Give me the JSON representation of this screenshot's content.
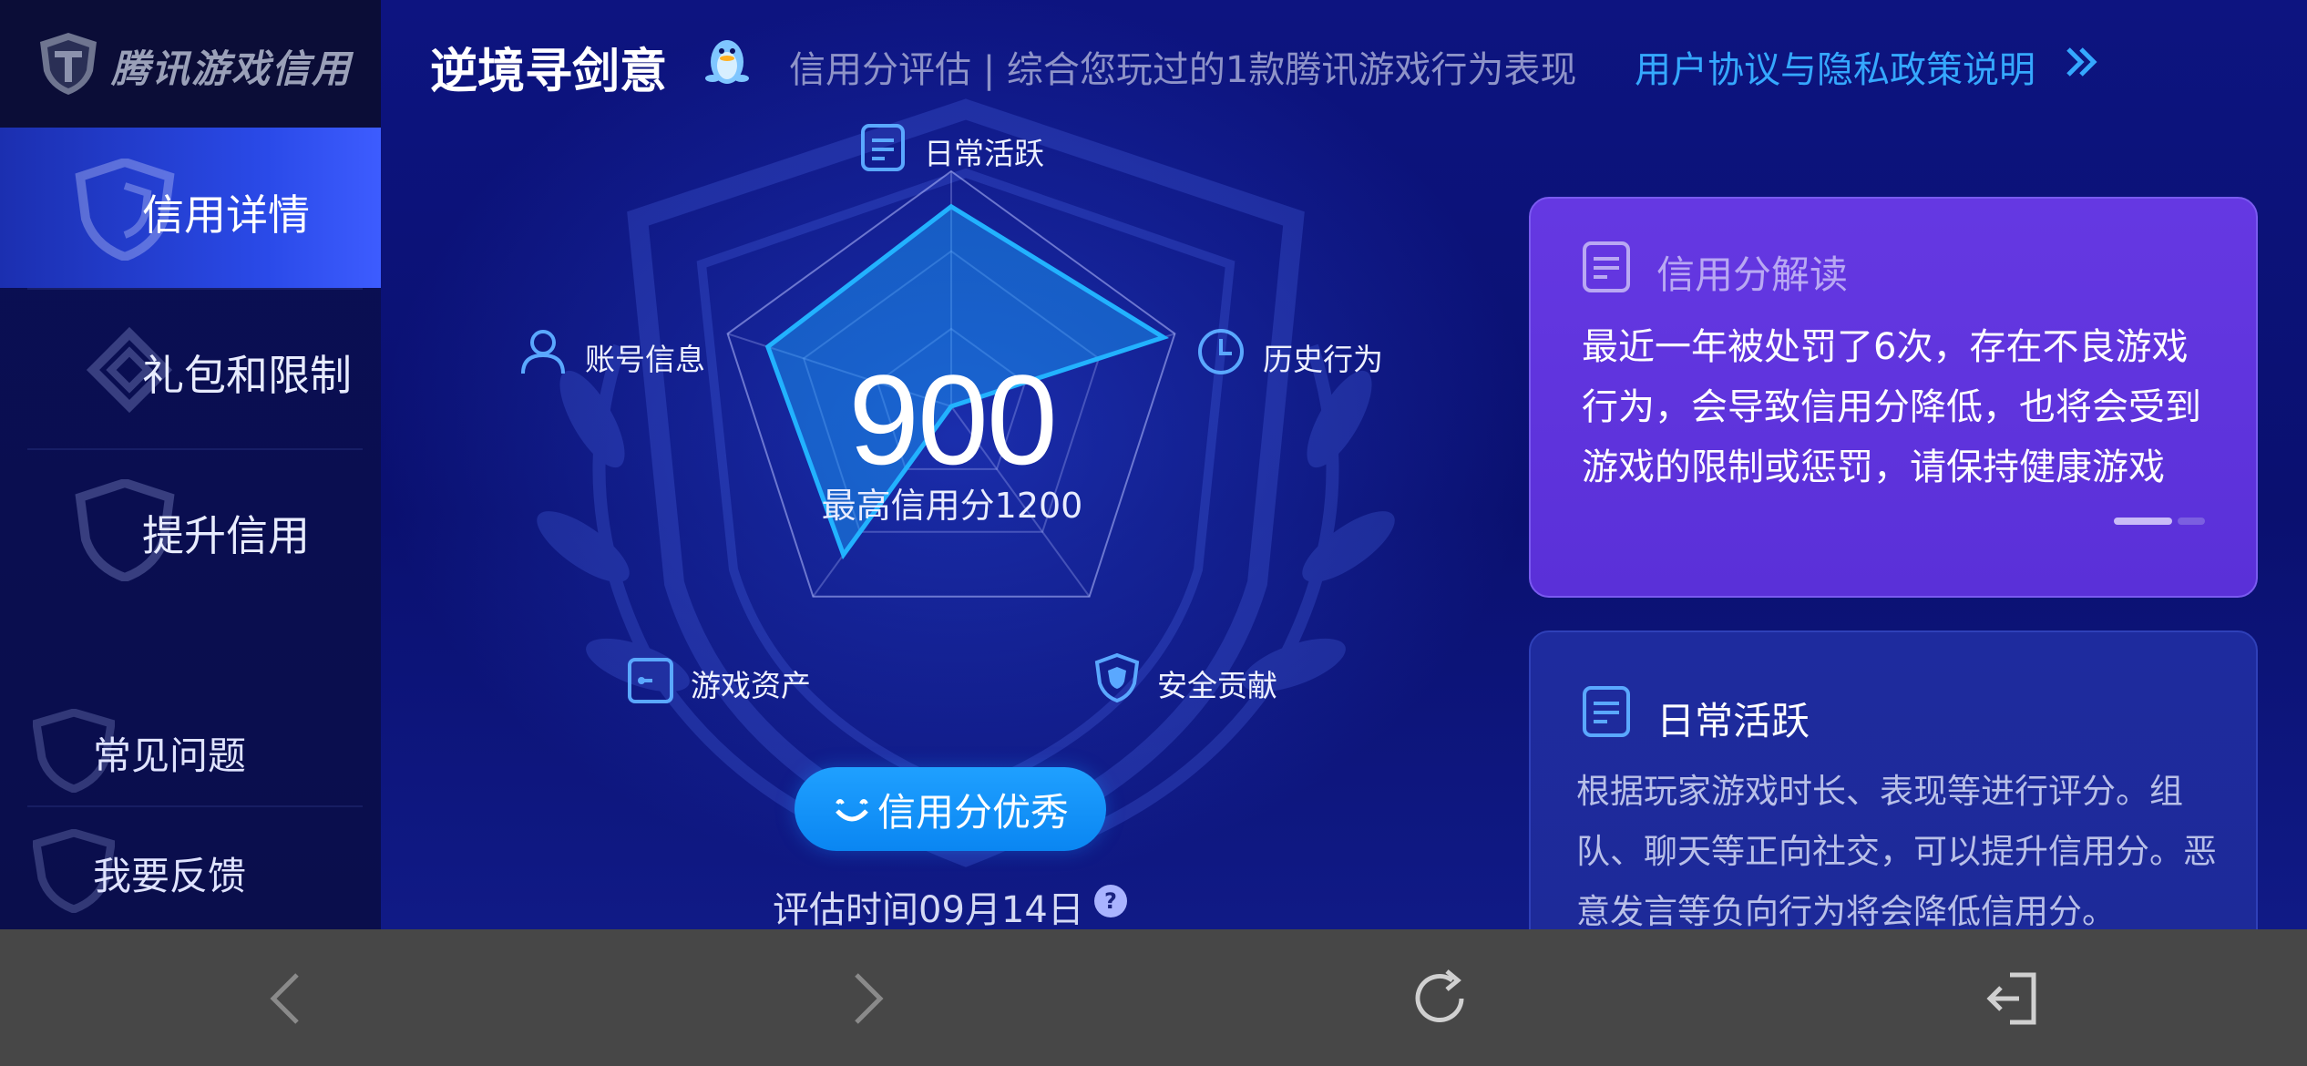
{
  "sidebar": {
    "brand": "腾讯游戏信用",
    "items": [
      {
        "label": "信用详情",
        "active": true
      },
      {
        "label": "礼包和限制",
        "active": false
      },
      {
        "label": "提升信用",
        "active": false
      }
    ],
    "bottom_items": [
      {
        "label": "常见问题"
      },
      {
        "label": "我要反馈"
      }
    ]
  },
  "header": {
    "title": "逆境寻剑意",
    "subtitle": "信用分评估 | 综合您玩过的1款腾讯游戏行为表现",
    "link": "用户协议与隐私政策说明"
  },
  "radar": {
    "score": "900",
    "max_label": "最高信用分1200",
    "axes": [
      {
        "label": "日常活跃",
        "icon": "document-icon",
        "value": 0.85
      },
      {
        "label": "历史行为",
        "icon": "clock-icon",
        "value": 0.95
      },
      {
        "label": "安全贡献",
        "icon": "shield-icon",
        "value": 0.0
      },
      {
        "label": "游戏资产",
        "icon": "wallet-icon",
        "value": 0.78
      },
      {
        "label": "账号信息",
        "icon": "user-icon",
        "value": 0.82
      }
    ],
    "rating": "信用分优秀",
    "eval_time": "评估时间09月14日"
  },
  "cards": {
    "interpretation": {
      "title": "信用分解读",
      "body": "最近一年被处罚了6次，存在不良游戏行为，会导致信用分降低，也将会受到游戏的限制或惩罚，请保持健康游戏"
    },
    "daily": {
      "title": "日常活跃",
      "body": "根据玩家游戏时长、表现等进行评分。组队、聊天等正向社交，可以提升信用分。恶意发言等负向行为将会降低信用分。"
    }
  },
  "browser_bar": {
    "buttons": [
      "back-icon",
      "forward-icon",
      "refresh-icon",
      "exit-icon"
    ]
  },
  "colors": {
    "background": "#0b0f5e",
    "accent_blue": "#35a8ff",
    "radar_fill": "#1aa6ff",
    "card_purple": "#6538e2",
    "card_blue": "#1e2b9e"
  }
}
